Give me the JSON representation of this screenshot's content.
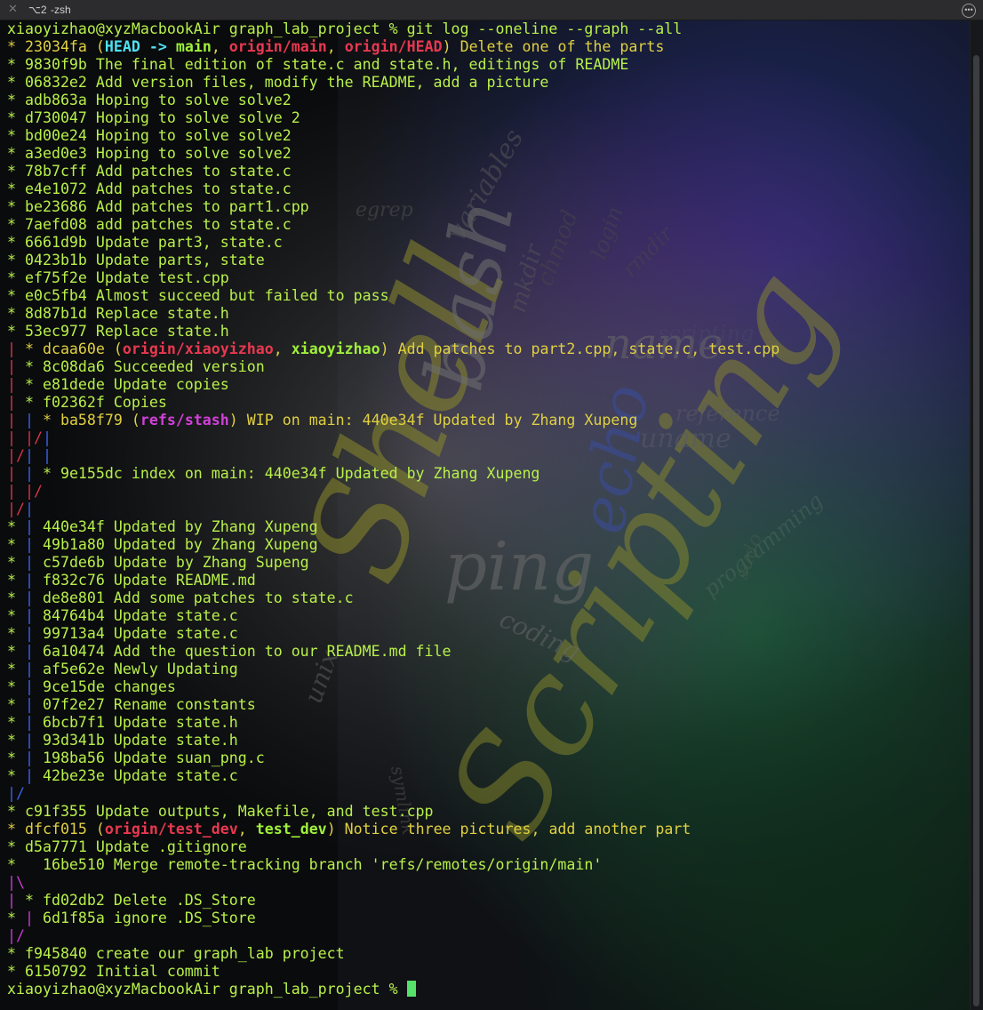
{
  "window": {
    "tab_number": "⌥2",
    "tab_title": "-zsh",
    "close_icon": "close-icon",
    "more_icon": "ellipsis-icon"
  },
  "background_words": [
    "Shell",
    "Scripting",
    "bash",
    "ping",
    "echo",
    "unix",
    "name",
    "uname",
    "variables",
    "mkdir",
    "coding",
    "programming",
    "reference",
    "scripting",
    "egrep",
    "symlink",
    "sudo",
    "login",
    "chmod",
    "rmdir"
  ],
  "terminal": {
    "prompt": "xiaoyizhao@xyzMacbookAir graph_lab_project % ",
    "command": "git log --oneline --graph --all",
    "colors": {
      "text": "#b8f04a",
      "branch_remote": "#e8384f",
      "head": "#4fe0f0",
      "stash": "#d040d8",
      "graph_red": "#d8364a",
      "graph_blue": "#3c62e8",
      "graph_magenta": "#c83cd0",
      "cursor": "#57e06a"
    },
    "lines": [
      [
        {
          "t": "xiaoyizhao@xyzMacbookAir graph_lab_project % git log --oneline --graph --all",
          "c": "green"
        }
      ],
      [
        {
          "t": "* 23034fa (",
          "c": "yellow"
        },
        {
          "t": "HEAD -> ",
          "c": "cyan"
        },
        {
          "t": "main",
          "c": "bgreen"
        },
        {
          "t": ", ",
          "c": "yellow"
        },
        {
          "t": "origin/main",
          "c": "red"
        },
        {
          "t": ", ",
          "c": "yellow"
        },
        {
          "t": "origin/HEAD",
          "c": "red"
        },
        {
          "t": ") Delete one of the parts",
          "c": "yellow"
        }
      ],
      [
        {
          "t": "* 9830f9b The final edition of state.c and state.h, editings of README",
          "c": "green"
        }
      ],
      [
        {
          "t": "* 06832e2 Add version files, modify the README, add a picture",
          "c": "green"
        }
      ],
      [
        {
          "t": "* adb863a Hoping to solve solve2",
          "c": "green"
        }
      ],
      [
        {
          "t": "* d730047 Hoping to solve solve 2",
          "c": "green"
        }
      ],
      [
        {
          "t": "* bd00e24 Hoping to solve solve2",
          "c": "green"
        }
      ],
      [
        {
          "t": "* a3ed0e3 Hoping to solve solve2",
          "c": "green"
        }
      ],
      [
        {
          "t": "* 78b7cff Add patches to state.c",
          "c": "green"
        }
      ],
      [
        {
          "t": "* e4e1072 Add patches to state.c",
          "c": "green"
        }
      ],
      [
        {
          "t": "* be23686 Add patches to part1.cpp",
          "c": "green"
        }
      ],
      [
        {
          "t": "* 7aefd08 add patches to state.c",
          "c": "green"
        }
      ],
      [
        {
          "t": "* 6661d9b Update part3, state.c",
          "c": "green"
        }
      ],
      [
        {
          "t": "* 0423b1b Update parts, state",
          "c": "green"
        }
      ],
      [
        {
          "t": "* ef75f2e Update test.cpp",
          "c": "green"
        }
      ],
      [
        {
          "t": "* e0c5fb4 Almost succeed but failed to pass",
          "c": "green"
        }
      ],
      [
        {
          "t": "* 8d87b1d Replace state.h",
          "c": "green"
        }
      ],
      [
        {
          "t": "* 53ec977 Replace state.h",
          "c": "green"
        }
      ],
      [
        {
          "t": "| ",
          "c": "gred"
        },
        {
          "t": "* dcaa60e (",
          "c": "yellow"
        },
        {
          "t": "origin/xiaoyizhao",
          "c": "red"
        },
        {
          "t": ", ",
          "c": "yellow"
        },
        {
          "t": "xiaoyizhao",
          "c": "bgreen"
        },
        {
          "t": ") Add patches to part2.cpp, state.c, test.cpp",
          "c": "yellow"
        }
      ],
      [
        {
          "t": "| ",
          "c": "gred"
        },
        {
          "t": "* 8c08da6 Succeeded version",
          "c": "green"
        }
      ],
      [
        {
          "t": "| ",
          "c": "gred"
        },
        {
          "t": "* e81dede Update copies",
          "c": "green"
        }
      ],
      [
        {
          "t": "| ",
          "c": "gred"
        },
        {
          "t": "* f02362f Copies",
          "c": "green"
        }
      ],
      [
        {
          "t": "| ",
          "c": "gred"
        },
        {
          "t": "| ",
          "c": "gblue"
        },
        {
          "t": "* ba58f79 (",
          "c": "yellow"
        },
        {
          "t": "refs/stash",
          "c": "magenta"
        },
        {
          "t": ") WIP on main: 440e34f Updated by Zhang Xupeng",
          "c": "yellow"
        }
      ],
      [
        {
          "t": "| ",
          "c": "gred"
        },
        {
          "t": "|/",
          "c": "gred"
        },
        {
          "t": "|",
          "c": "gblue"
        }
      ],
      [
        {
          "t": "|/",
          "c": "gred"
        },
        {
          "t": "| ",
          "c": "gblue"
        },
        {
          "t": "|",
          "c": "gblue"
        }
      ],
      [
        {
          "t": "| ",
          "c": "gred"
        },
        {
          "t": "| ",
          "c": "gblue"
        },
        {
          "t": "* 9e155dc index on main: 440e34f Updated by Zhang Xupeng",
          "c": "green"
        }
      ],
      [
        {
          "t": "| ",
          "c": "gred"
        },
        {
          "t": "|/",
          "c": "gred"
        }
      ],
      [
        {
          "t": "|/",
          "c": "gred"
        },
        {
          "t": "|",
          "c": "gblue"
        }
      ],
      [
        {
          "t": "* ",
          "c": "green"
        },
        {
          "t": "| ",
          "c": "gblue"
        },
        {
          "t": "440e34f Updated by Zhang Xupeng",
          "c": "green"
        }
      ],
      [
        {
          "t": "* ",
          "c": "green"
        },
        {
          "t": "| ",
          "c": "gblue"
        },
        {
          "t": "49b1a80 Updated by Zhang Xupeng",
          "c": "green"
        }
      ],
      [
        {
          "t": "* ",
          "c": "green"
        },
        {
          "t": "| ",
          "c": "gblue"
        },
        {
          "t": "c57de6b Update by Zhang Supeng",
          "c": "green"
        }
      ],
      [
        {
          "t": "* ",
          "c": "green"
        },
        {
          "t": "| ",
          "c": "gblue"
        },
        {
          "t": "f832c76 Update README.md",
          "c": "green"
        }
      ],
      [
        {
          "t": "* ",
          "c": "green"
        },
        {
          "t": "| ",
          "c": "gblue"
        },
        {
          "t": "de8e801 Add some patches to state.c",
          "c": "green"
        }
      ],
      [
        {
          "t": "* ",
          "c": "green"
        },
        {
          "t": "| ",
          "c": "gblue"
        },
        {
          "t": "84764b4 Update state.c",
          "c": "green"
        }
      ],
      [
        {
          "t": "* ",
          "c": "green"
        },
        {
          "t": "| ",
          "c": "gblue"
        },
        {
          "t": "99713a4 Update state.c",
          "c": "green"
        }
      ],
      [
        {
          "t": "* ",
          "c": "green"
        },
        {
          "t": "| ",
          "c": "gblue"
        },
        {
          "t": "6a10474 Add the question to our README.md file",
          "c": "green"
        }
      ],
      [
        {
          "t": "* ",
          "c": "green"
        },
        {
          "t": "| ",
          "c": "gblue"
        },
        {
          "t": "af5e62e Newly Updating",
          "c": "green"
        }
      ],
      [
        {
          "t": "* ",
          "c": "green"
        },
        {
          "t": "| ",
          "c": "gblue"
        },
        {
          "t": "9ce15de changes",
          "c": "green"
        }
      ],
      [
        {
          "t": "* ",
          "c": "green"
        },
        {
          "t": "| ",
          "c": "gblue"
        },
        {
          "t": "07f2e27 Rename constants",
          "c": "green"
        }
      ],
      [
        {
          "t": "* ",
          "c": "green"
        },
        {
          "t": "| ",
          "c": "gblue"
        },
        {
          "t": "6bcb7f1 Update state.h",
          "c": "green"
        }
      ],
      [
        {
          "t": "* ",
          "c": "green"
        },
        {
          "t": "| ",
          "c": "gblue"
        },
        {
          "t": "93d341b Update state.h",
          "c": "green"
        }
      ],
      [
        {
          "t": "* ",
          "c": "green"
        },
        {
          "t": "| ",
          "c": "gblue"
        },
        {
          "t": "198ba56 Update suan_png.c",
          "c": "green"
        }
      ],
      [
        {
          "t": "* ",
          "c": "green"
        },
        {
          "t": "| ",
          "c": "gblue"
        },
        {
          "t": "42be23e Update state.c",
          "c": "green"
        }
      ],
      [
        {
          "t": "|/",
          "c": "gblue"
        }
      ],
      [
        {
          "t": "* c91f355 Update outputs, Makefile, and test.cpp",
          "c": "green"
        }
      ],
      [
        {
          "t": "* dfcf015 (",
          "c": "yellow"
        },
        {
          "t": "origin/test_dev",
          "c": "red"
        },
        {
          "t": ", ",
          "c": "yellow"
        },
        {
          "t": "test_dev",
          "c": "bgreen"
        },
        {
          "t": ") Notice three pictures, add another part",
          "c": "yellow"
        }
      ],
      [
        {
          "t": "* d5a7771 Update .gitignore",
          "c": "green"
        }
      ],
      [
        {
          "t": "*   16be510 Merge remote-tracking branch 'refs/remotes/origin/main'",
          "c": "green"
        }
      ],
      [
        {
          "t": "|\\",
          "c": "gmagenta"
        }
      ],
      [
        {
          "t": "| ",
          "c": "gmagenta"
        },
        {
          "t": "* fd02db2 Delete .DS_Store",
          "c": "green"
        }
      ],
      [
        {
          "t": "* ",
          "c": "green"
        },
        {
          "t": "| ",
          "c": "gmagenta"
        },
        {
          "t": "6d1f85a ignore .DS_Store",
          "c": "green"
        }
      ],
      [
        {
          "t": "|/",
          "c": "gmagenta"
        }
      ],
      [
        {
          "t": "* f945840 create our graph_lab project",
          "c": "green"
        }
      ],
      [
        {
          "t": "* 6150792 Initial commit",
          "c": "green"
        }
      ]
    ],
    "final_prompt": "xiaoyizhao@xyzMacbookAir graph_lab_project % "
  }
}
